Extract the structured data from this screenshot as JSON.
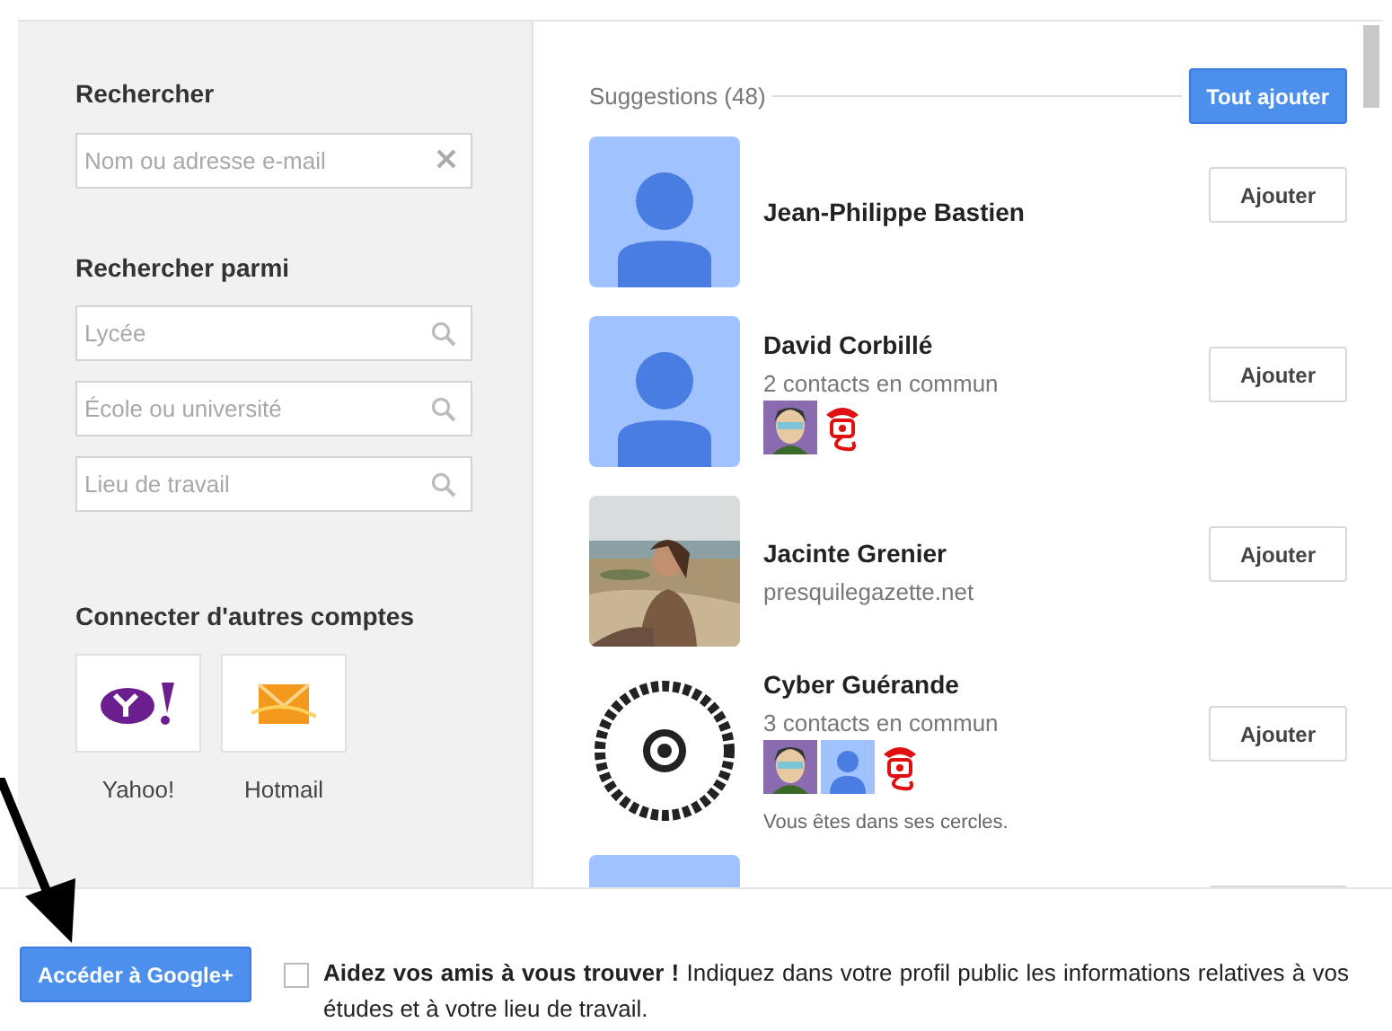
{
  "search": {
    "heading": "Rechercher",
    "field": {
      "placeholder": "Nom ou adresse e-mail"
    }
  },
  "search_among": {
    "heading": "Rechercher parmi",
    "fields": [
      {
        "placeholder": "Lycée"
      },
      {
        "placeholder": "École ou université"
      },
      {
        "placeholder": "Lieu de travail"
      }
    ]
  },
  "accounts": {
    "heading": "Connecter d'autres comptes",
    "items": [
      {
        "kind": "yahoo",
        "label": "Yahoo!"
      },
      {
        "kind": "hotmail",
        "label": "Hotmail"
      }
    ]
  },
  "suggestions": {
    "title": "Suggestions (48)",
    "add_all": "Tout ajouter",
    "contacts": [
      {
        "kind": "default",
        "name": "Jean-Philippe Bastien",
        "button": "Ajouter"
      },
      {
        "kind": "default",
        "name": "David Corbillé",
        "detail": "2 contacts en commun",
        "mutual": [
          {
            "kind": "cartoon"
          },
          {
            "kind": "phone"
          }
        ],
        "button": "Ajouter"
      },
      {
        "name": "Jacinte Grenier",
        "detail": "presquilegazette.net",
        "button": "Ajouter"
      },
      {
        "kind": "logo",
        "name": "Cyber Guérande",
        "detail": "3 contacts en commun",
        "mutual": [
          {
            "kind": "cartoon"
          },
          {
            "kind": "default"
          },
          {
            "kind": "phone"
          }
        ],
        "note": "Vous êtes dans ses cercles.",
        "button": "Ajouter"
      },
      {
        "kind": "default"
      }
    ]
  },
  "footer": {
    "button": "Accéder à Google+",
    "checkbox": {
      "checked": false
    },
    "text": "**Aidez vos amis à vous trouver !** Indiquez dans votre profil public les informations relatives à vos études et à votre lieu de travail."
  }
}
